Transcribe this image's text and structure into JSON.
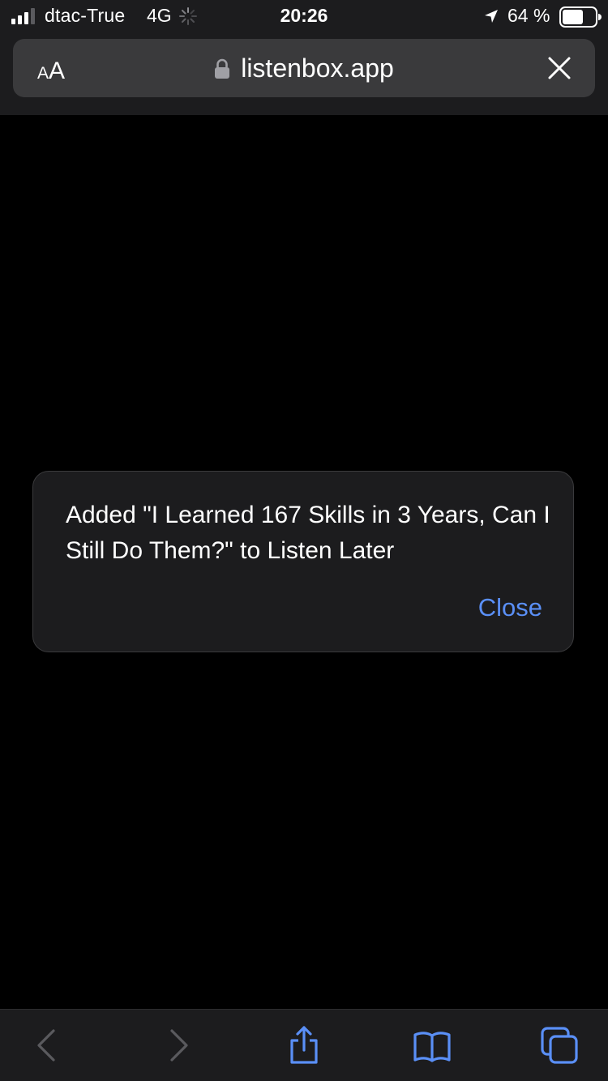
{
  "status_bar": {
    "carrier": "dtac-True",
    "network": "4G",
    "time": "20:26",
    "battery_percent": "64 %",
    "battery_level": 0.64,
    "signal_bars": 3,
    "icons": [
      "signal-icon",
      "loading-spinner-icon",
      "location-arrow-icon",
      "battery-icon"
    ]
  },
  "address_bar": {
    "text_size_small": "A",
    "text_size_large": "A",
    "url": "listenbox.app",
    "icons": [
      "lock-icon",
      "close-icon"
    ]
  },
  "dialog": {
    "message": "Added \"I Learned 167 Skills in 3 Years, Can I Still Do Them?\" to Listen Later",
    "close_label": "Close"
  },
  "toolbar": {
    "icons": [
      "back-icon",
      "forward-icon",
      "share-icon",
      "bookmarks-icon",
      "tabs-icon"
    ]
  },
  "colors": {
    "background": "#000000",
    "chrome": "#1c1c1e",
    "address_field": "#3a3a3c",
    "accent": "#5a8ff6",
    "disabled_icon": "#5a5a5e"
  }
}
